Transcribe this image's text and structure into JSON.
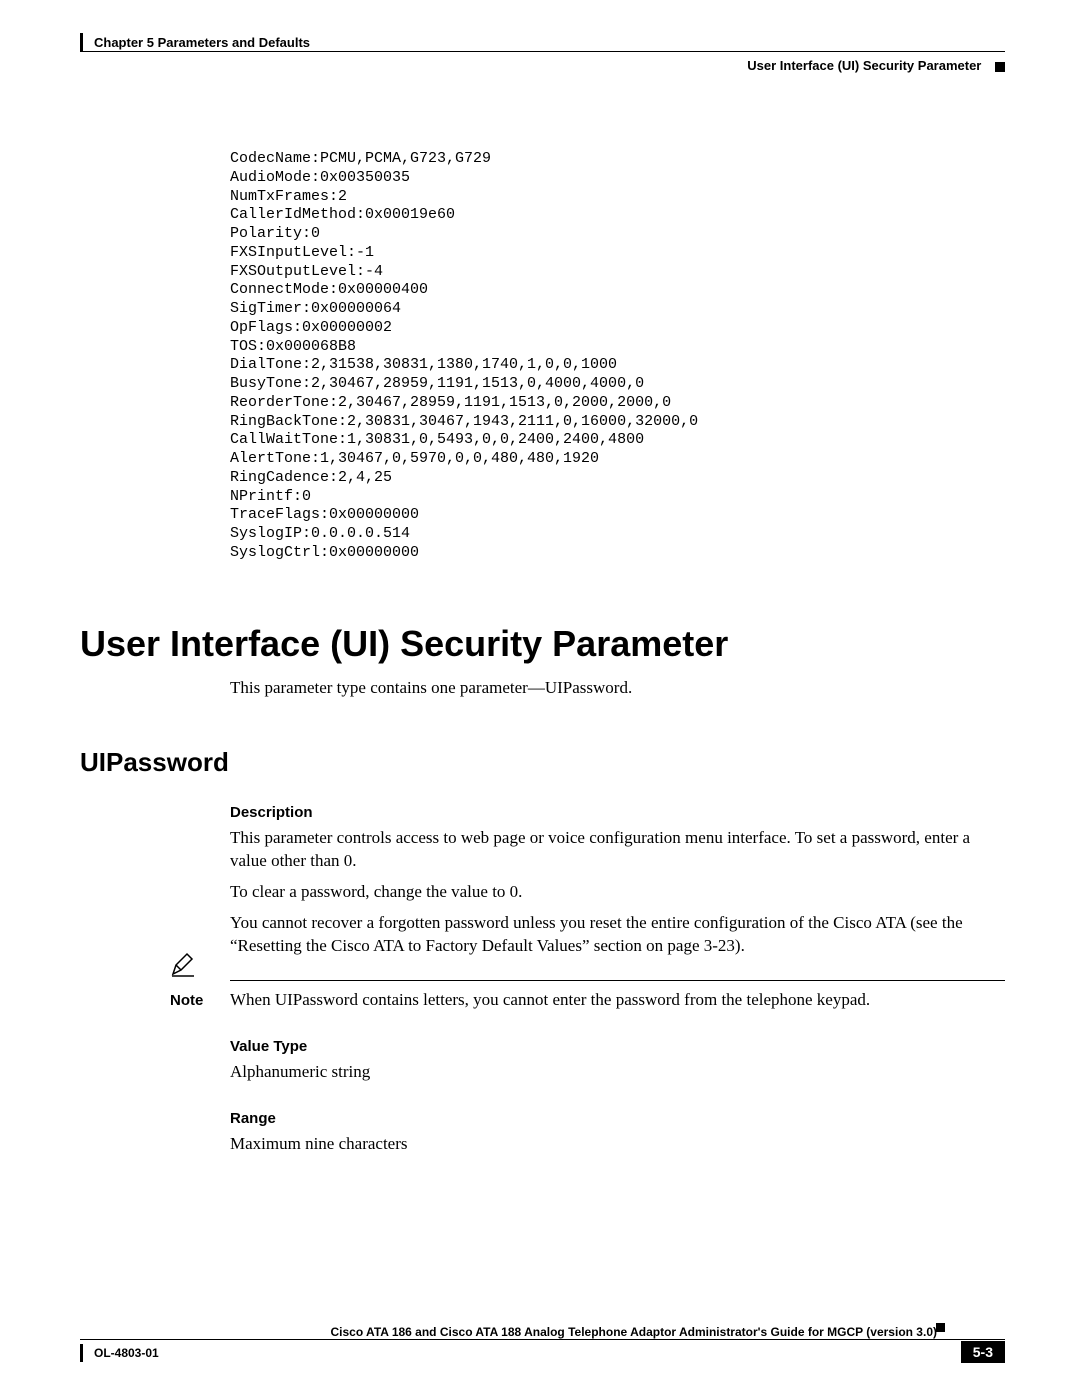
{
  "header": {
    "chapter": "Chapter 5    Parameters and Defaults",
    "section": "User Interface (UI) Security Parameter"
  },
  "codeblock": "CodecName:PCMU,PCMA,G723,G729\nAudioMode:0x00350035\nNumTxFrames:2\nCallerIdMethod:0x00019e60\nPolarity:0\nFXSInputLevel:-1\nFXSOutputLevel:-4\nConnectMode:0x00000400\nSigTimer:0x00000064\nOpFlags:0x00000002\nTOS:0x000068B8\nDialTone:2,31538,30831,1380,1740,1,0,0,1000\nBusyTone:2,30467,28959,1191,1513,0,4000,4000,0\nReorderTone:2,30467,28959,1191,1513,0,2000,2000,0\nRingBackTone:2,30831,30467,1943,2111,0,16000,32000,0\nCallWaitTone:1,30831,0,5493,0,0,2400,2400,4800\nAlertTone:1,30467,0,5970,0,0,480,480,1920\nRingCadence:2,4,25\nNPrintf:0\nTraceFlags:0x00000000\nSyslogIP:0.0.0.0.514\nSyslogCtrl:0x00000000",
  "main": {
    "h1": "User Interface (UI) Security Parameter",
    "intro": "This parameter type contains one parameter—UIPassword.",
    "h2": "UIPassword",
    "desc_label": "Description",
    "desc_p1": "This parameter controls access to web page or voice configuration menu interface. To set a password, enter a value other than 0.",
    "desc_p2": "To clear a password, change the value to 0.",
    "desc_p3": "You cannot recover a forgotten password unless you reset the entire configuration of the Cisco ATA (see the “Resetting the Cisco ATA to Factory Default Values” section on page 3-23).",
    "note_label": "Note",
    "note_text": "When UIPassword contains letters, you cannot enter the password from the telephone keypad.",
    "valuetype_label": "Value Type",
    "valuetype_text": "Alphanumeric string",
    "range_label": "Range",
    "range_text": "Maximum nine characters"
  },
  "footer": {
    "guide": "Cisco ATA 186 and Cisco ATA 188 Analog Telephone Adaptor Administrator's Guide for MGCP (version 3.0)",
    "doc_id": "OL-4803-01",
    "page": "5-3"
  }
}
